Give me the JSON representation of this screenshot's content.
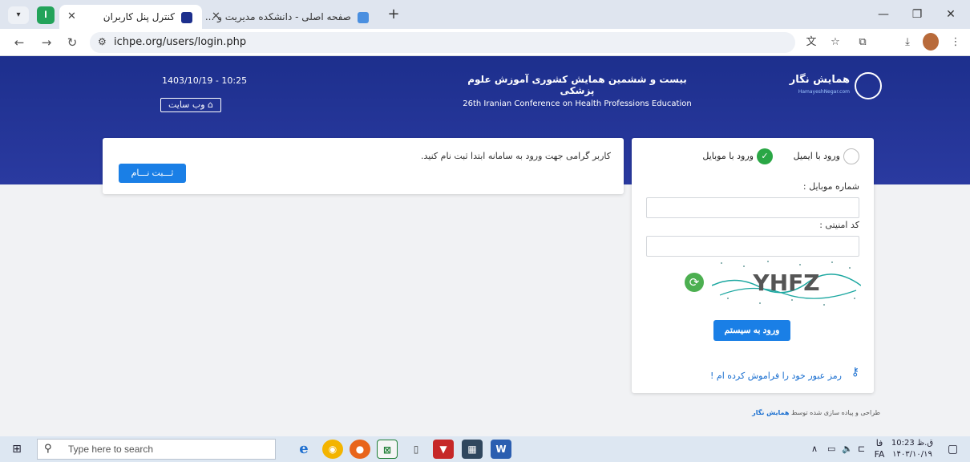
{
  "browser": {
    "tabs": [
      {
        "label": "کنترل پنل کاربران",
        "active": true
      },
      {
        "label": "صفحه اصلی - دانشکده مدیریت و ...",
        "active": false
      }
    ],
    "url": "ichpe.org/users/login.php"
  },
  "banner": {
    "datetime": "1403/10/19 - 10:25",
    "site_button": "وب سایت",
    "conference_fa": "بیست و ششمین همایش کشوری آموزش علوم پزشکی",
    "conference_en": "26th Iranian Conference on Health Professions Education",
    "logo_name": "همایش نگار",
    "logo_sub": "HamayeshNegar.com"
  },
  "register_card": {
    "message": "کاربر گرامی جهت ورود به سامانه ابتدا ثبت نام کنید.",
    "button": "ثـــبت نـــام"
  },
  "login_card": {
    "option_email": "ورود با ایمیل",
    "option_mobile": "ورود با موبایل",
    "selected": "mobile",
    "mobile_label": "شماره موبایل :",
    "mobile_value": "",
    "captcha_label": "کد امنیتی :",
    "captcha_value": "",
    "captcha_text": "YHFZ",
    "submit": "ورود به سیستم",
    "forgot": "رمز عبور خود را فراموش کرده ام !"
  },
  "footer": {
    "credit": "طراحی و پیاده سازی شده توسط",
    "brand": "همایش نگار"
  },
  "taskbar": {
    "search_placeholder": "Type here to search",
    "lang": "FA",
    "lang_fa": "فا",
    "time": "10:23 ق.ظ",
    "date": "۱۴۰۳/۱۰/۱۹"
  }
}
